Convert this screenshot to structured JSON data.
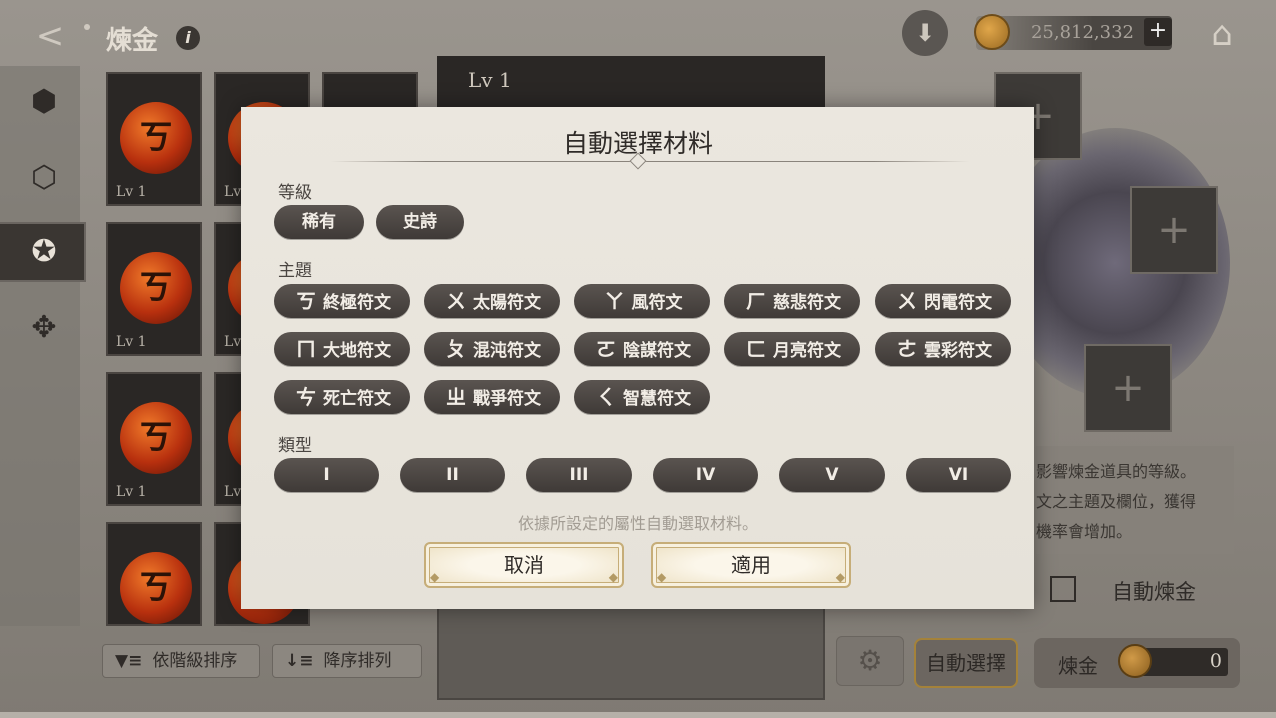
{
  "header": {
    "title": "煉金",
    "currency": "25,812,332"
  },
  "inventory": {
    "cards": [
      {
        "level": "Lv 1",
        "rune": "ㄎ"
      },
      {
        "level": "Lv 1",
        "rune": "ㄎ"
      },
      {
        "level": "Lv 1",
        "rune": "ㄎ"
      },
      {
        "level": "",
        "rune": "ㄎ"
      }
    ],
    "partial_level": "Lv",
    "sort_by_tier": "依階級排序",
    "sort_descending": "降序排列"
  },
  "center": {
    "level": "Lv 1"
  },
  "right": {
    "desc_lines": [
      "影響煉金道具的等級。",
      "文之主題及欄位，獲得",
      "機率會增加。"
    ],
    "auto_alchemy_label": "自動煉金",
    "auto_select_label": "自動選擇",
    "alchemy_label": "煉金",
    "alchemy_count": "0"
  },
  "modal": {
    "title": "自動選擇材料",
    "grade_label": "等級",
    "grades": [
      "稀有",
      "史詩"
    ],
    "theme_label": "主題",
    "themes": [
      {
        "icon": "ㄎ",
        "label": "終極符文"
      },
      {
        "icon": "ㄨ",
        "label": "太陽符文"
      },
      {
        "icon": "ㄚ",
        "label": "風符文"
      },
      {
        "icon": "ㄏ",
        "label": "慈悲符文"
      },
      {
        "icon": "ㄨ",
        "label": "閃電符文"
      },
      {
        "icon": "ㄇ",
        "label": "大地符文"
      },
      {
        "icon": "ㄆ",
        "label": "混沌符文"
      },
      {
        "icon": "ㄛ",
        "label": "陰謀符文"
      },
      {
        "icon": "ㄈ",
        "label": "月亮符文"
      },
      {
        "icon": "ㄜ",
        "label": "雲彩符文"
      },
      {
        "icon": "ㄘ",
        "label": "死亡符文"
      },
      {
        "icon": "ㄓ",
        "label": "戰爭符文"
      },
      {
        "icon": "ㄑ",
        "label": "智慧符文"
      }
    ],
    "type_label": "類型",
    "types": [
      "I",
      "II",
      "III",
      "IV",
      "V",
      "VI"
    ],
    "hint": "依據所設定的屬性自動選取材料。",
    "cancel": "取消",
    "apply": "適用"
  }
}
